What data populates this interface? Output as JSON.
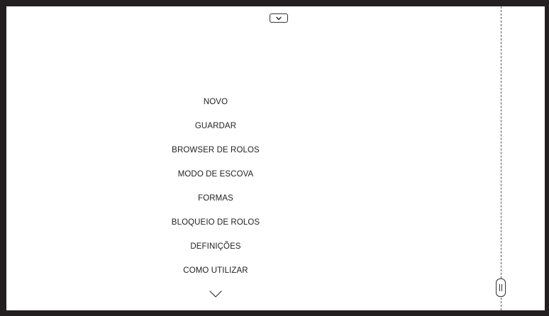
{
  "menu": {
    "items": [
      {
        "label": "NOVO"
      },
      {
        "label": "GUARDAR"
      },
      {
        "label": "BROWSER DE ROLOS"
      },
      {
        "label": "MODO DE ESCOVA"
      },
      {
        "label": "FORMAS"
      },
      {
        "label": "BLOQUEIO DE ROLOS"
      },
      {
        "label": "DEFINIÇÕES"
      },
      {
        "label": "COMO UTILIZAR"
      }
    ]
  },
  "icons": {
    "top_toggle": "chevron-down-icon",
    "more": "chevron-down-icon",
    "side_handle": "grip-handle-icon"
  },
  "colors": {
    "background": "#231f20",
    "canvas": "#ffffff",
    "text": "#222222"
  }
}
